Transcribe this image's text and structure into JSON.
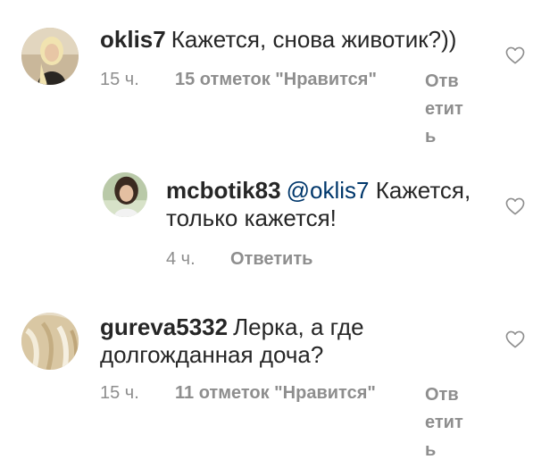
{
  "comments": [
    {
      "username": "oklis7",
      "text": "Кажется, снова животик?))",
      "time": "15 ч.",
      "likes": "15 отметок \"Нравится\"",
      "reply": "Ответить",
      "avatar": "avatar-blonde-woman",
      "icon": "heart-outline-icon"
    },
    {
      "username": "mcbotik83",
      "mention": "@oklis7",
      "text_line1": "Кажется,",
      "text_line2": "только кажется!",
      "time": "4 ч.",
      "reply": "Ответить",
      "avatar": "avatar-dark-hair-woman",
      "icon": "heart-outline-icon"
    },
    {
      "username": "gureva5332",
      "text_line1": "Лерка, а где",
      "text_line2": "долгожданная доча?",
      "time": "15 ч.",
      "likes": "11 отметок \"Нравится\"",
      "reply": "Ответить",
      "avatar": "avatar-blonde-hair-closeup",
      "icon": "heart-outline-icon"
    }
  ],
  "colors": {
    "text": "#262626",
    "meta": "#8e8e8e",
    "mention": "#00376b",
    "background": "#ffffff"
  }
}
